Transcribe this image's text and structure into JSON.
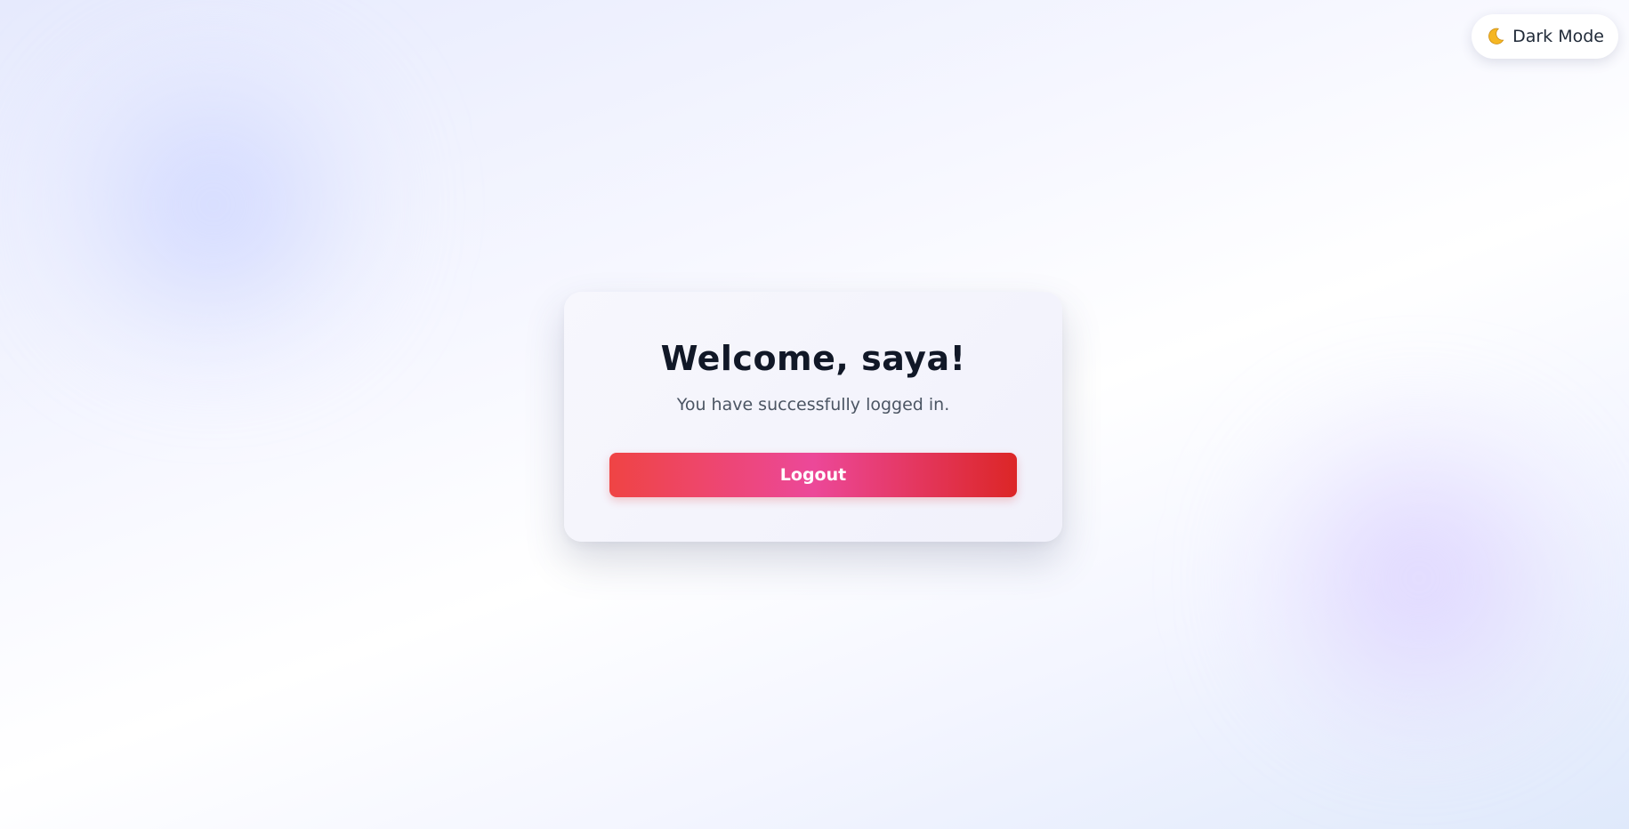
{
  "theme_toggle": {
    "icon": "moon-icon",
    "label": "Dark Mode"
  },
  "welcome_card": {
    "title": "Welcome, saya!",
    "subtitle": "You have successfully logged in.",
    "logout_label": "Logout"
  },
  "colors": {
    "button_gradient_start": "#ef4444",
    "button_gradient_mid": "#ec4899",
    "button_gradient_end": "#dc2626",
    "title_text": "#111827",
    "subtitle_text": "#4b5563",
    "moon": "#f5b623"
  }
}
